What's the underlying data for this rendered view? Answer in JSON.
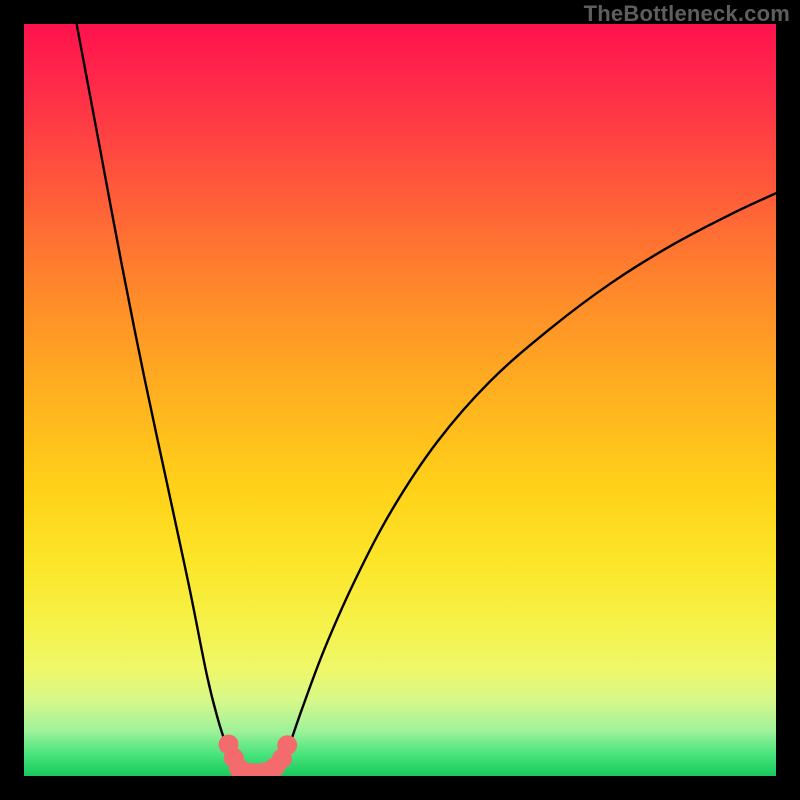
{
  "attribution": "TheBottleneck.com",
  "colors": {
    "background_frame": "#000000",
    "curve_stroke": "#000000",
    "marker_fill": "#f46b6d",
    "gradient_top": "#ff124d",
    "gradient_bottom": "#18c95a"
  },
  "chart_data": {
    "type": "line",
    "title": "",
    "xlabel": "",
    "ylabel": "",
    "xlim": [
      0,
      100
    ],
    "ylim": [
      0,
      100
    ],
    "grid": false,
    "annotations": [],
    "series": [
      {
        "name": "left-branch",
        "x": [
          7.0,
          10.0,
          13.0,
          16.0,
          19.0,
          22.0,
          24.3,
          25.8,
          27.0,
          27.8,
          28.3
        ],
        "y": [
          100,
          84,
          68,
          53,
          39,
          25,
          13.5,
          7.5,
          3.8,
          1.8,
          0.6
        ]
      },
      {
        "name": "valley-floor",
        "x": [
          28.3,
          29.0,
          30.0,
          31.0,
          32.0,
          33.0,
          33.8
        ],
        "y": [
          0.6,
          0.25,
          0.15,
          0.15,
          0.25,
          0.4,
          0.8
        ]
      },
      {
        "name": "right-branch",
        "x": [
          33.8,
          35.0,
          37.0,
          40.0,
          44.0,
          49.0,
          55.0,
          62.0,
          70.0,
          78.0,
          86.0,
          94.0,
          100.0
        ],
        "y": [
          0.8,
          3.3,
          9.0,
          17.0,
          26.0,
          35.5,
          44.5,
          52.5,
          59.5,
          65.5,
          70.5,
          74.7,
          77.5
        ]
      }
    ],
    "markers": {
      "name": "valley-markers",
      "shape": "circle",
      "color": "#f46b6d",
      "points": [
        {
          "x": 27.2,
          "y": 4.2,
          "r": 1.0
        },
        {
          "x": 27.9,
          "y": 2.4,
          "r": 1.0
        },
        {
          "x": 28.6,
          "y": 1.0,
          "r": 1.0
        },
        {
          "x": 29.4,
          "y": 0.5,
          "r": 1.0
        },
        {
          "x": 30.4,
          "y": 0.3,
          "r": 1.1
        },
        {
          "x": 31.5,
          "y": 0.3,
          "r": 1.1
        },
        {
          "x": 32.5,
          "y": 0.6,
          "r": 1.0
        },
        {
          "x": 33.4,
          "y": 1.2,
          "r": 1.0
        },
        {
          "x": 34.3,
          "y": 2.3,
          "r": 1.0
        },
        {
          "x": 35.0,
          "y": 4.1,
          "r": 1.0
        }
      ]
    }
  }
}
